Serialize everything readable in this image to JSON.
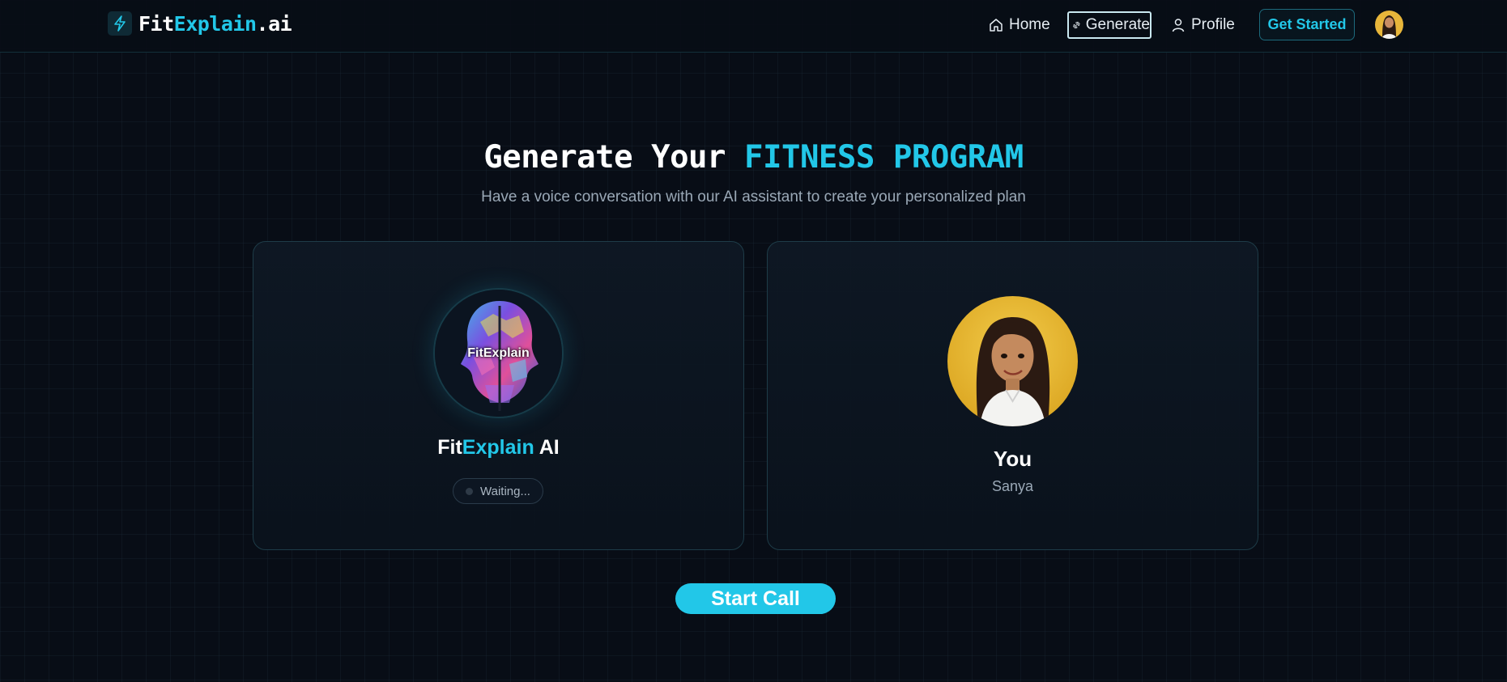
{
  "brand": {
    "part1": "Fit",
    "part2": "Explain",
    "part3": ".ai",
    "logo_icon": "lightning-icon"
  },
  "nav": {
    "home": {
      "label": "Home",
      "icon": "home-icon"
    },
    "generate": {
      "label": "Generate",
      "icon": "dumbbell-icon"
    },
    "profile": {
      "label": "Profile",
      "icon": "user-icon"
    },
    "cta": "Get Started"
  },
  "hero": {
    "title_plain": "Generate Your ",
    "title_accent": "FITNESS PROGRAM",
    "subtitle": "Have a voice conversation with our AI assistant to create your personalized plan"
  },
  "assistant": {
    "avatar_label": "FitExplain",
    "name_part1": "Fit",
    "name_part2": "Explain",
    "name_part3": " AI",
    "status": "Waiting..."
  },
  "user": {
    "heading": "You",
    "name": "Sanya"
  },
  "actions": {
    "start_call": "Start Call"
  },
  "colors": {
    "accent": "#22c7e8",
    "background": "#080d16",
    "card_border": "#1e3c48"
  }
}
